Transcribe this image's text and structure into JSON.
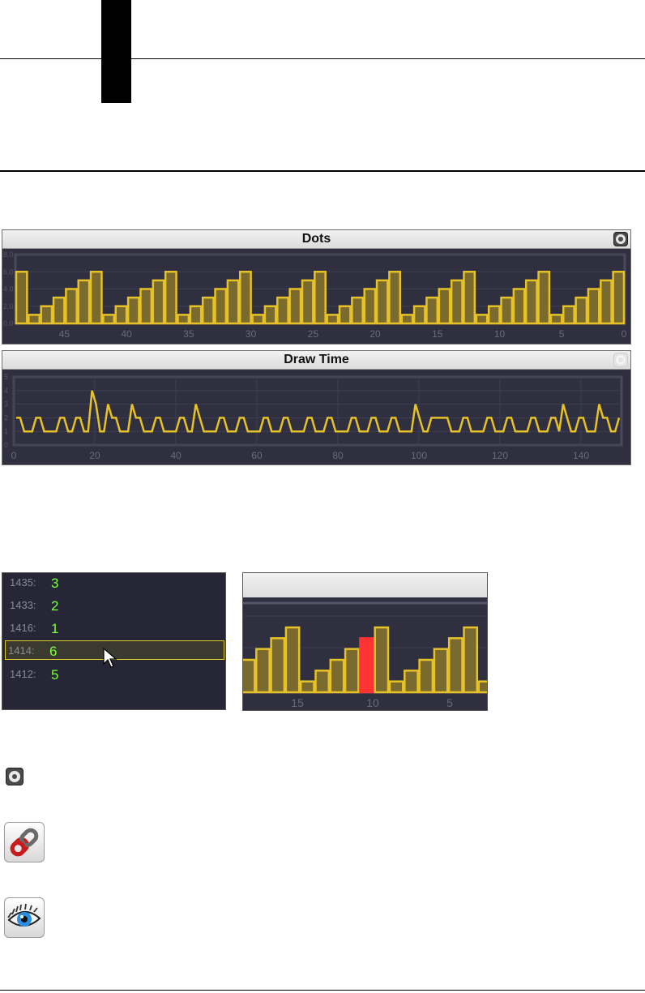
{
  "colors": {
    "panel_bg": "#2f2f3f",
    "grid": "#3e3e52",
    "bar_fill": "#7a6a2e",
    "bar_stroke": "#e6c227",
    "line": "#e6c227",
    "highlight_bar": "#ff3333",
    "value_text": "#7dff3a"
  },
  "dots_panel": {
    "title": "Dots",
    "settings_icon": "settings-icon",
    "chart_data": {
      "type": "bar",
      "y_ticks": [
        "0.0",
        "2.0",
        "4.0",
        "6.0",
        "8.0"
      ],
      "ylim": [
        0,
        8
      ],
      "x_ticks": [
        "45",
        "40",
        "35",
        "30",
        "25",
        "20",
        "15",
        "10",
        "5",
        "0"
      ],
      "values": [
        6,
        1,
        2,
        3,
        4,
        5,
        6,
        1,
        2,
        3,
        4,
        5,
        6,
        1,
        2,
        3,
        4,
        5,
        6,
        1,
        2,
        3,
        4,
        5,
        6,
        1,
        2,
        3,
        4,
        5,
        6,
        1,
        2,
        3,
        4,
        5,
        6,
        1,
        2,
        3,
        4,
        5,
        6,
        1,
        2,
        3,
        4,
        5,
        6
      ]
    }
  },
  "draw_time_panel": {
    "title": "Draw Time",
    "settings_icon": "settings-icon",
    "chart_data": {
      "type": "line",
      "y_ticks": [
        "0",
        "1",
        "2",
        "3",
        "4",
        "5"
      ],
      "ylim": [
        0,
        5
      ],
      "x_ticks": [
        "0",
        "20",
        "40",
        "60",
        "80",
        "100",
        "120",
        "140"
      ],
      "xlim": [
        0,
        150
      ],
      "values": [
        2,
        2,
        1,
        1,
        1,
        2,
        2,
        1,
        1,
        1,
        1,
        2,
        2,
        1,
        1,
        2,
        2,
        1,
        1,
        4,
        3,
        1,
        1,
        3,
        2,
        2,
        1,
        1,
        1,
        3,
        2,
        2,
        1,
        1,
        1,
        2,
        2,
        1,
        1,
        1,
        1,
        2,
        2,
        1,
        1,
        3,
        2,
        1,
        1,
        1,
        1,
        2,
        2,
        1,
        1,
        1,
        2,
        2,
        1,
        1,
        1,
        1,
        2,
        2,
        1,
        1,
        1,
        2,
        2,
        1,
        1,
        1,
        1,
        2,
        2,
        1,
        1,
        1,
        2,
        2,
        1,
        1,
        1,
        1,
        2,
        2,
        1,
        1,
        1,
        2,
        2,
        1,
        1,
        1,
        2,
        2,
        1,
        1,
        1,
        1,
        3,
        2,
        1,
        1,
        2,
        2,
        2,
        2,
        2,
        1,
        1,
        1,
        2,
        2,
        1,
        1,
        1,
        1,
        2,
        2,
        1,
        1,
        1,
        2,
        2,
        1,
        1,
        1,
        1,
        2,
        2,
        1,
        1,
        1,
        2,
        2,
        1,
        3,
        2,
        1,
        1,
        2,
        2,
        1,
        1,
        1,
        3,
        2,
        2,
        1,
        1,
        2
      ]
    }
  },
  "value_list": {
    "rows": [
      {
        "label": "1435:",
        "value": "3"
      },
      {
        "label": "1433:",
        "value": "2"
      },
      {
        "label": "1416:",
        "value": "1"
      },
      {
        "label": "1414:",
        "value": "6"
      },
      {
        "label": "1412:",
        "value": "5"
      }
    ],
    "selected_index": 3
  },
  "zoomed_chart": {
    "chart_data": {
      "type": "bar",
      "values": [
        3,
        4,
        5,
        6,
        1,
        2,
        3,
        4,
        5,
        6,
        1,
        2,
        3,
        4,
        5,
        6,
        1
      ],
      "highlight_index": 8,
      "x_ticks": [
        "15",
        "10",
        "5"
      ]
    }
  },
  "icons": [
    "settings-icon",
    "link-icon",
    "eye-icon"
  ]
}
